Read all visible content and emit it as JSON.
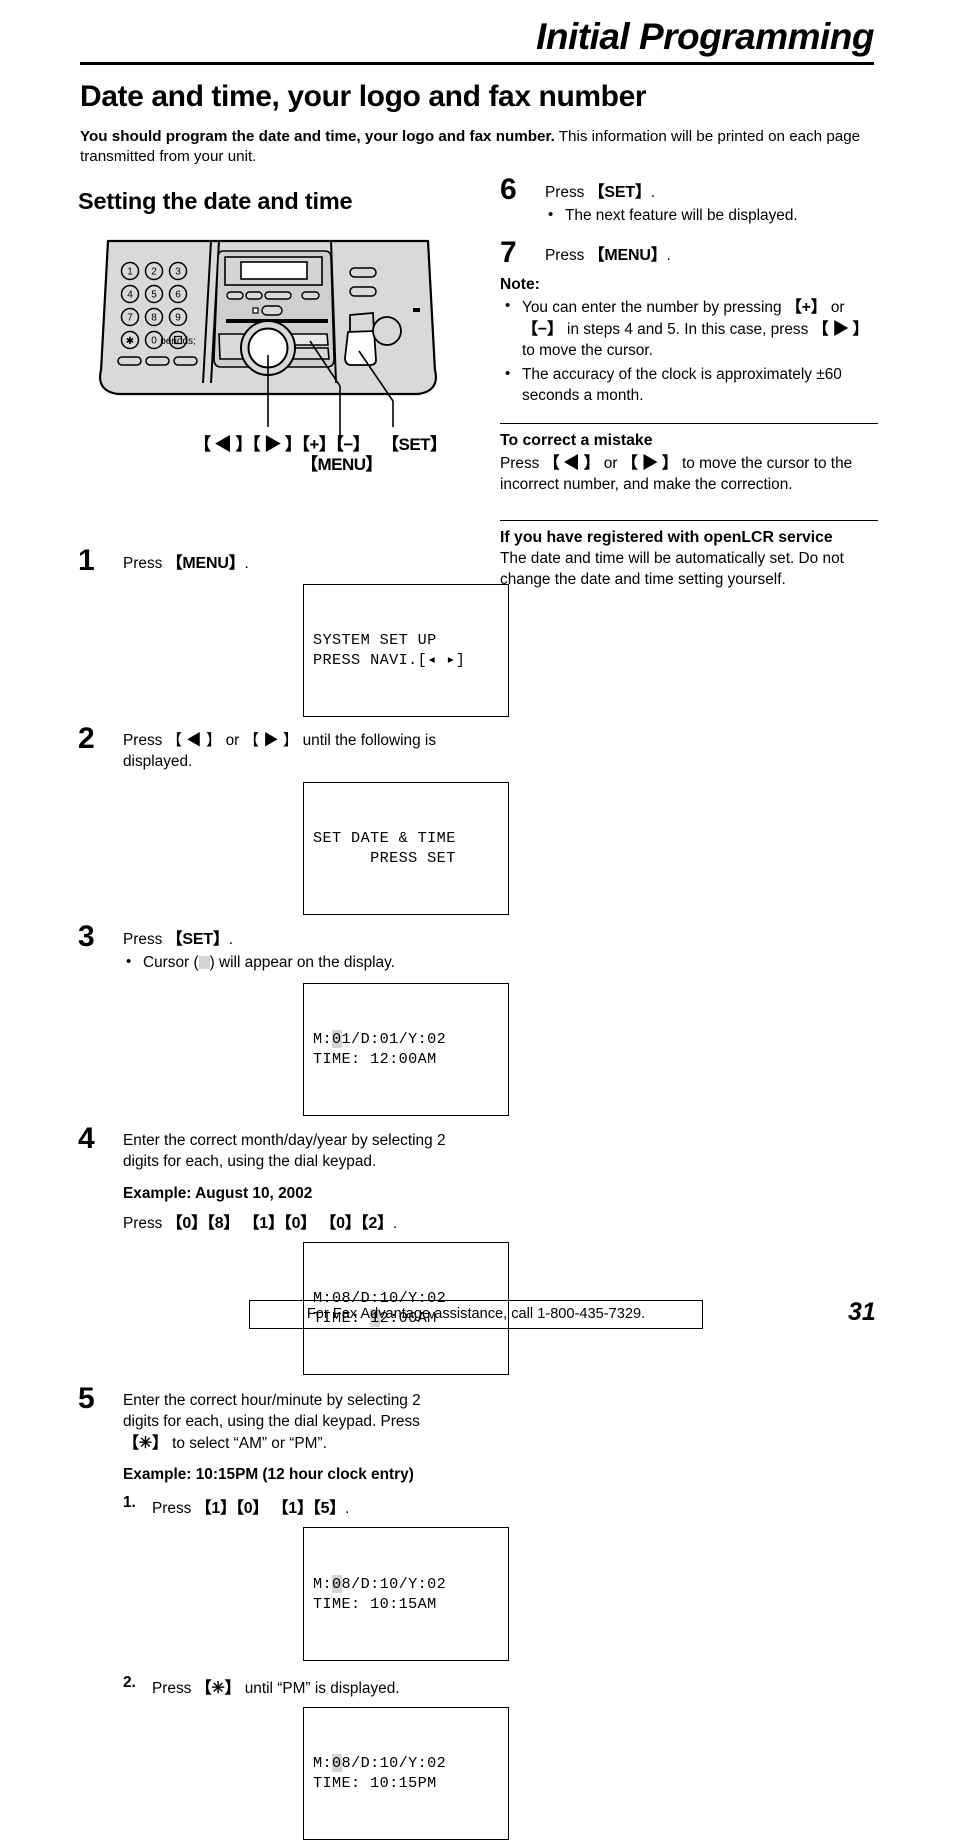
{
  "header": {
    "title": "Initial Programming"
  },
  "doc": {
    "title": "Date and time, your logo and fax number",
    "intro_bold": "You should program the date and time, your logo and fax number.",
    "intro_rest": " This information will be printed on each page transmitted from your unit."
  },
  "left": {
    "section_heading": "Setting the date and time",
    "figure": {
      "keypad": [
        "1",
        "2",
        "3",
        "4",
        "5",
        "6",
        "7",
        "8",
        "9",
        "✳",
        "0",
        "⌗"
      ],
      "callouts": {
        "navigator": "【 ◀ 】【 ▶ 】【+】【−】",
        "menu": "【MENU】",
        "set": "【SET】"
      }
    },
    "steps": [
      {
        "num": "1",
        "text_before": "Press ",
        "key": "【MENU】",
        "text_after": ".",
        "lcd": {
          "line1": "SYSTEM SET UP",
          "line2": "PRESS NAVI.[◂ ▸]"
        }
      },
      {
        "num": "2",
        "text": "Press 【 ◀ 】 or 【 ▶ 】 until the following is displayed.",
        "lcd": {
          "line1": "SET DATE & TIME",
          "line2": "      PRESS SET"
        }
      },
      {
        "num": "3",
        "text_before": "Press ",
        "key": "【SET】",
        "text_after": ".",
        "bullet": "Cursor (▮) will appear on the display.",
        "bullet_pre": "Cursor (",
        "bullet_post": ") will appear on the display.",
        "lcd": {
          "pre1": "M:",
          "cur1": "0",
          "post1": "1/D:01/Y:02",
          "line2": "TIME: 12:00AM"
        }
      },
      {
        "num": "4",
        "text": "Enter the correct month/day/year by selecting 2 digits for each, using the dial keypad.",
        "example_head": "Example: August 10, 2002",
        "press_pre": "Press ",
        "press_keys": "【0】【8】 【1】【0】 【0】【2】",
        "press_post": ".",
        "lcd": {
          "line1": "M:08/D:10/Y:02",
          "pre2": "TIME: ",
          "cur2": "1",
          "post2": "2:00AM"
        }
      },
      {
        "num": "5",
        "text_a": "Enter the correct hour/minute by selecting 2 digits for each, using the dial keypad. Press ",
        "text_key": "【✳】",
        "text_b": " to select “AM” or “PM”.",
        "example_head": "Example: 10:15PM (12 hour clock entry)",
        "sub1": {
          "num": "1.",
          "pre": "Press ",
          "keys": "【1】【0】 【1】【5】",
          "post": ".",
          "lcd": {
            "pre1": "M:",
            "cur1": "0",
            "post1": "8/D:10/Y:02",
            "line2": "TIME: 10:15AM"
          }
        },
        "sub2": {
          "num": "2.",
          "pre": "Press ",
          "keys": "【✳】",
          "post": " until “PM” is displayed.",
          "lcd": {
            "pre1": "M:",
            "cur1": "0",
            "post1": "8/D:10/Y:02",
            "line2": "TIME: 10:15PM"
          }
        }
      }
    ]
  },
  "right": {
    "step6": {
      "num": "6",
      "pre": "Press ",
      "key": "【SET】",
      "post": ".",
      "bullet": "The next feature will be displayed."
    },
    "step7": {
      "num": "7",
      "pre": "Press ",
      "key": "【MENU】",
      "post": "."
    },
    "note_head": "Note:",
    "note_b1_a": "You can enter the number by pressing ",
    "note_b1_k1": "【+】",
    "note_b1_b": " or ",
    "note_b1_k2": "【−】",
    "note_b1_c": " in steps 4 and 5. In this case, press ",
    "note_b1_k3": "【 ▶ 】",
    "note_b1_d": " to move the cursor.",
    "note_b2": "The accuracy of the clock is approximately ±60 seconds a month.",
    "correct_head": "To correct a mistake",
    "correct_a": "Press ",
    "correct_k1": "【 ◀ 】",
    "correct_b": " or ",
    "correct_k2": "【 ▶ 】",
    "correct_c": " to move the cursor to the incorrect number, and make the correction.",
    "lcr_head": "If you have registered with openLCR service",
    "lcr_body": "The date and time will be automatically set. Do not change the date and time setting yourself."
  },
  "footer": {
    "notice": "For Fax Advantage assistance, call 1-800-435-7329.",
    "page_number": "31"
  }
}
